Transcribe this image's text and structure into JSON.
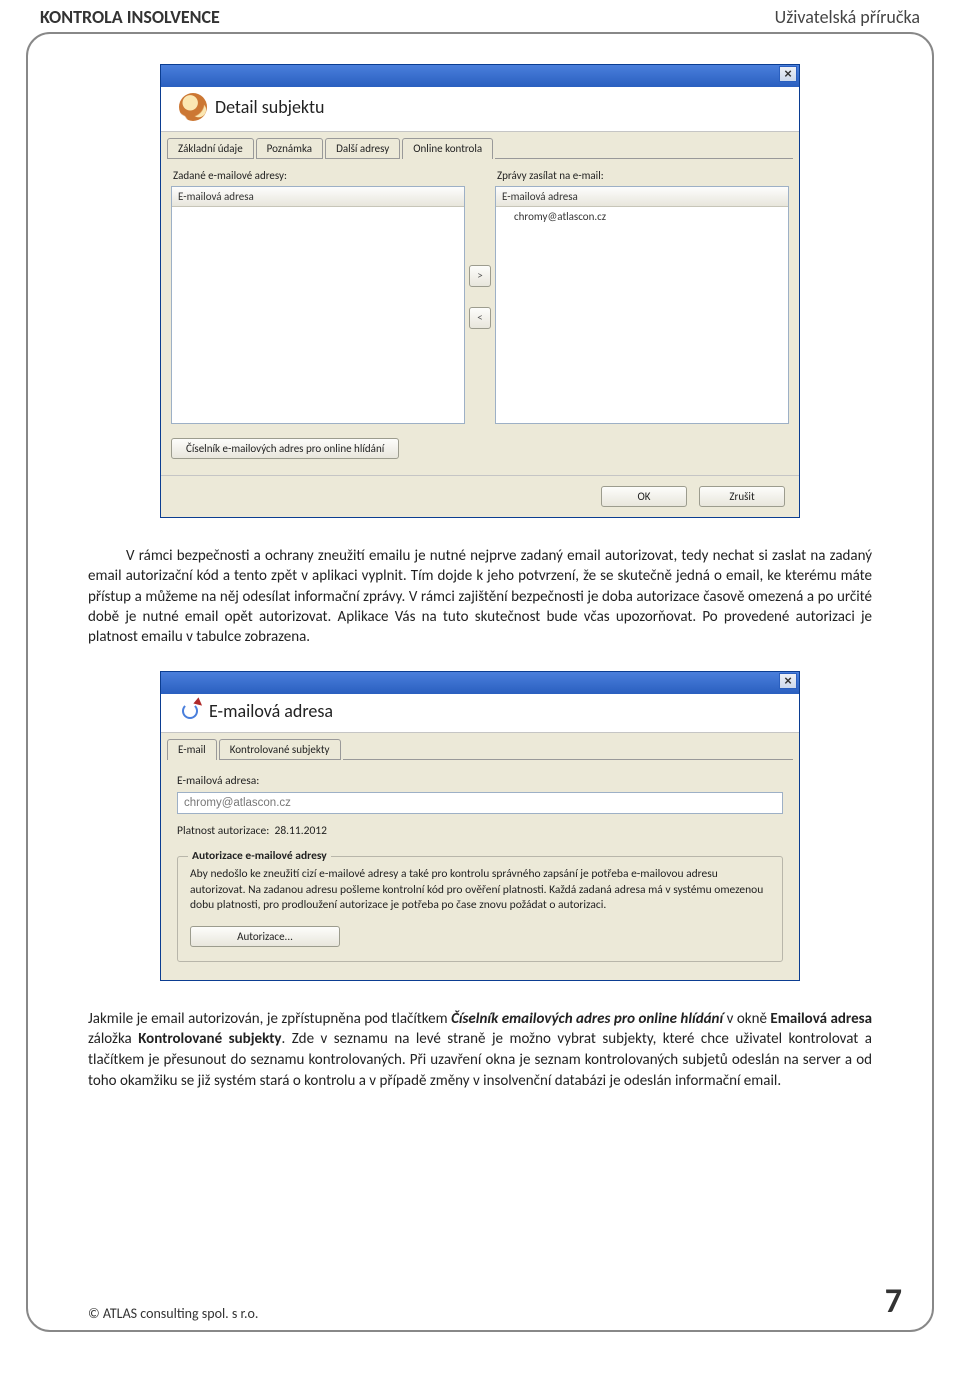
{
  "header": {
    "left": "KONTROLA INSOLVENCE",
    "right": "Uživatelská příručka"
  },
  "dialog1": {
    "title": "Detail subjektu",
    "close": "×",
    "tabs": [
      "Základní údaje",
      "Poznámka",
      "Další adresy",
      "Online kontrola"
    ],
    "active_tab": 3,
    "left_label": "Zadané e-mailové adresy:",
    "right_label": "Zprávy zasílat na e-mail:",
    "col_header": "E-mailová adresa",
    "right_row1": "chromy@atlascon.cz",
    "btn_right": ">",
    "btn_left": "<",
    "long_button": "Číselník e-mailových adres pro online hlídání",
    "ok": "OK",
    "cancel": "Zrušit"
  },
  "paragraph1": "V rámci bezpečnosti a ochrany zneužití emailu je nutné nejprve zadaný email autorizovat, tedy nechat si zaslat na zadaný email autorizační kód a tento zpět v aplikaci vyplnit. Tím dojde k jeho potvrzení, že se skutečně jedná o email, ke kterému máte přístup a můžeme na něj odesílat informační zprávy. V rámci zajištění bezpečnosti je doba autorizace časově omezená a po určité době je nutné email opět autorizovat. Aplikace Vás na tuto skutečnost bude včas upozorňovat. Po provedené autorizaci je platnost emailu v tabulce zobrazena.",
  "dialog2": {
    "title": "E-mailová adresa",
    "close": "×",
    "tabs": [
      "E-mail",
      "Kontrolované subjekty"
    ],
    "active_tab": 0,
    "label_email": "E-mailová adresa:",
    "email_value": "chromy@atlascon.cz",
    "validity_label": "Platnost autorizace:",
    "validity_date": "28.11.2012",
    "group_title": "Autorizace e-mailové adresy",
    "group_text": "Aby nedošlo ke zneužití cizí e-mailové adresy a také pro kontrolu správného zapsání je potřeba e-mailovou adresu autorizovat. Na zadanou adresu pošleme kontrolní kód pro ověření platnosti. Každá zadaná adresa má v systému omezenou dobu platnosti, pro prodloužení autorizace je potřeba po čase znovu požádat o autorizaci.",
    "auth_button": "Autorizace..."
  },
  "paragraph2_parts": {
    "p0": "Jakmile je email autorizován, je zpřístupněna pod tlačítkem ",
    "p1": "Číselník emailových adres pro online hlídání",
    "p2": " v okně ",
    "p3": "Emailová adresa",
    "p4": " záložka ",
    "p5": "Kontrolované subjekty",
    "p6": ". Zde v seznamu na levé straně je možno vybrat subjekty, které chce uživatel kontrolovat a tlačítkem je přesunout do seznamu kontrolovaných. Při uzavření okna je seznam kontrolovaných subjetů odeslán na server a od toho okamžiku se již systém stará o kontrolu a v případě změny v insolvenční databázi je odeslán informační email."
  },
  "footer": {
    "copyright": "© ATLAS consulting spol. s r.o.",
    "page": "7"
  }
}
